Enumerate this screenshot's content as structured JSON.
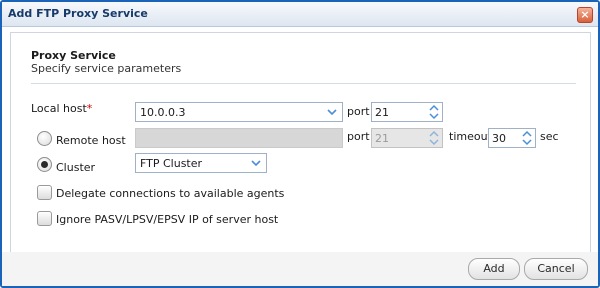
{
  "window": {
    "title": "Add FTP Proxy Service",
    "close_glyph": "×"
  },
  "section": {
    "title": "Proxy Service",
    "subtitle": "Specify service parameters"
  },
  "local_host": {
    "label": "Local host",
    "required_mark": "*",
    "value": "10.0.0.3",
    "port_label": "port",
    "port_value": "21"
  },
  "remote_host": {
    "label": "Remote host",
    "selected": false,
    "port_label": "port",
    "port_value": "21",
    "timeout_label": "timeout",
    "timeout_value": "30",
    "timeout_unit": "sec"
  },
  "cluster": {
    "label": "Cluster",
    "selected": true,
    "value": "FTP Cluster"
  },
  "options": {
    "delegate": {
      "label": "Delegate connections to available agents",
      "checked": false
    },
    "ignore_pasv": {
      "label": "Ignore PASV/LPSV/EPSV IP of server host",
      "checked": false
    }
  },
  "buttons": {
    "add": "Add",
    "cancel": "Cancel"
  },
  "colors": {
    "title_text": "#163a6a",
    "window_border": "#1a63b8",
    "arrow": "#4a8ed8"
  },
  "icons": {
    "close": "close-icon",
    "dropdown": "chevron-down-icon",
    "spin": "spin-arrows-icon"
  }
}
